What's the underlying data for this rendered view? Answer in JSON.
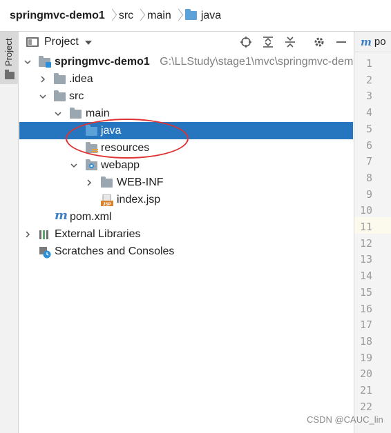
{
  "breadcrumb": {
    "project": "springmvc-demo1",
    "seg1": "src",
    "seg2": "main",
    "seg3": "java"
  },
  "stripe": {
    "label": "Project"
  },
  "panel": {
    "title": "Project"
  },
  "tree": {
    "root_label": "springmvc-demo1",
    "root_path": "G:\\LLStudy\\stage1\\mvc\\springmvc-dem",
    "idea": ".idea",
    "src": "src",
    "main": "main",
    "java": "java",
    "resources": "resources",
    "webapp": "webapp",
    "webinf": "WEB-INF",
    "index": "index.jsp",
    "pom": "pom.xml",
    "external": "External Libraries",
    "scratches": "Scratches and Consoles"
  },
  "editor": {
    "tab_label": "po",
    "line_numbers": [
      "1",
      "2",
      "3",
      "4",
      "5",
      "6",
      "7",
      "8",
      "9",
      "10",
      "11",
      "12",
      "13",
      "14",
      "15",
      "16",
      "17",
      "18",
      "19",
      "20",
      "21",
      "22"
    ]
  },
  "watermark": "CSDN @CAUC_lin",
  "colors": {
    "selection": "#2675bf",
    "folder_blue": "#5aa2d8",
    "annotation": "#e03232"
  }
}
